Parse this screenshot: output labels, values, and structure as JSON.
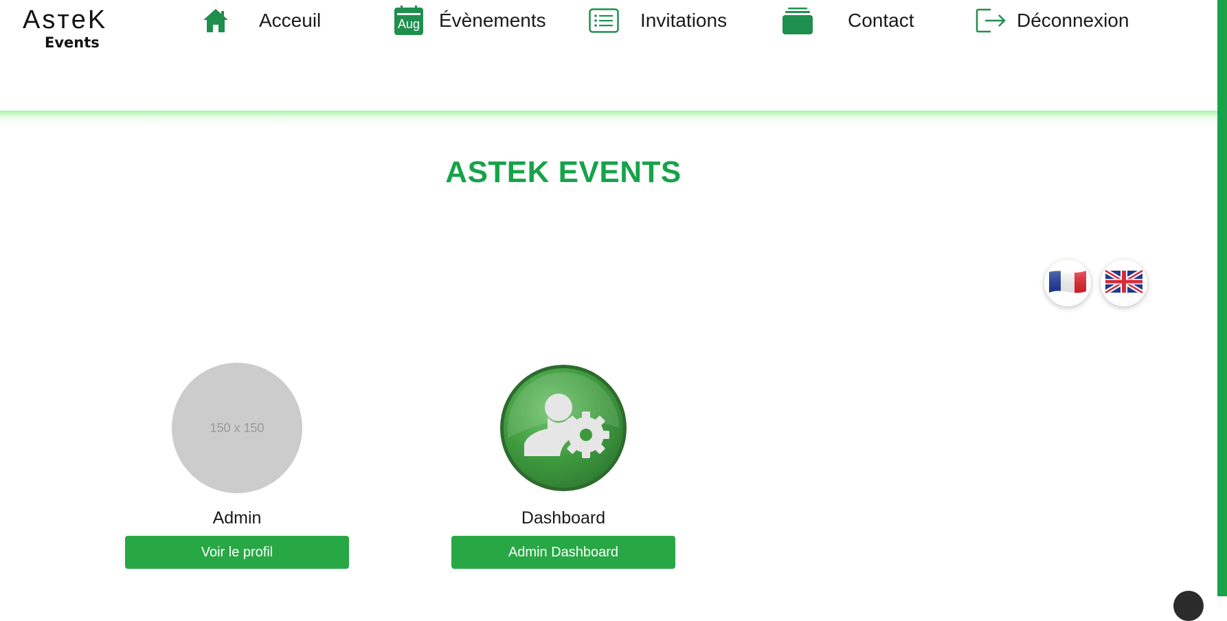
{
  "logo": {
    "main": "AsтeK",
    "sub": "Events"
  },
  "nav": [
    {
      "label": "Acceuil",
      "icon": "home-icon"
    },
    {
      "label": "Évènements",
      "icon": "calendar-icon",
      "icon_text": "Aug"
    },
    {
      "label": "Invitations",
      "icon": "list-icon"
    },
    {
      "label": "Contact",
      "icon": "stack-icon"
    },
    {
      "label": "Déconnexion",
      "icon": "logout-icon"
    }
  ],
  "title": "ASTEK EVENTS",
  "languages": [
    {
      "name": "Français",
      "icon": "france-flag-icon"
    },
    {
      "name": "English",
      "icon": "uk-flag-icon"
    }
  ],
  "cards": [
    {
      "image_text": "150 x 150",
      "title": "Admin",
      "button": "Voir le profil"
    },
    {
      "title": "Dashboard",
      "button": "Admin Dashboard",
      "icon": "admin-settings-icon"
    }
  ],
  "colors": {
    "accent": "#16a34a",
    "button": "#28a745",
    "placeholder": "#cccccc"
  }
}
